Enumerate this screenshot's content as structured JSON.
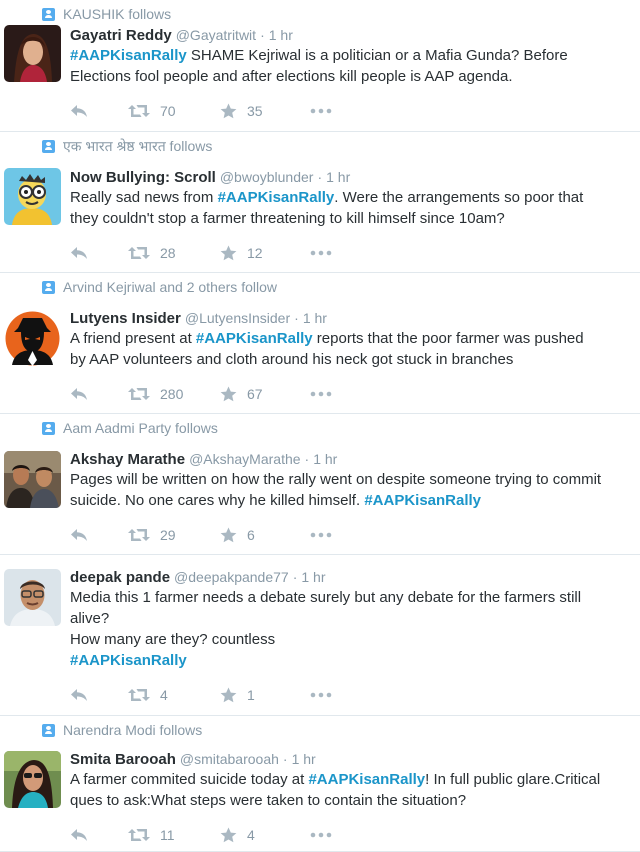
{
  "tweets": [
    {
      "context": "KAUSHIK follows",
      "fullname": "Gayatri Reddy",
      "handle": "@Gayatritwit",
      "time": "1 hr",
      "lines": [
        [
          {
            "text": "#AAPKisanRally",
            "hashtag": true
          },
          {
            "text": " SHAME Kejriwal is a politician or a Mafia Gunda? Before"
          }
        ],
        [
          {
            "text": "Elections fool people and after elections kill people is AAP agenda."
          }
        ]
      ],
      "retweets": "70",
      "favorites": "35",
      "avatar": "woman-portrait"
    },
    {
      "context": "एक भारत श्रेष्ठ भारत follows",
      "fullname": "Now Bullying: Scroll",
      "handle": "@bwoyblunder",
      "time": "1 hr",
      "lines": [
        [
          {
            "text": "Really sad news from "
          },
          {
            "text": "#AAPKisanRally",
            "hashtag": true
          },
          {
            "text": ". Were the arrangements so poor that"
          }
        ],
        [
          {
            "text": "they couldn't stop a farmer threatening to kill himself since 10am?"
          }
        ]
      ],
      "retweets": "28",
      "favorites": "12",
      "avatar": "cartoon-glasses"
    },
    {
      "context": "Arvind Kejriwal and 2 others follow",
      "fullname": "Lutyens Insider",
      "handle": "@LutyensInsider",
      "time": "1 hr",
      "lines": [
        [
          {
            "text": "A friend present at "
          },
          {
            "text": "#AAPKisanRally",
            "hashtag": true
          },
          {
            "text": " reports that the poor farmer was pushed"
          }
        ],
        [
          {
            "text": "by AAP volunteers and cloth around his neck got stuck in branches"
          }
        ]
      ],
      "retweets": "280",
      "favorites": "67",
      "avatar": "spy-silhouette"
    },
    {
      "context": "Aam Aadmi Party follows",
      "fullname": "Akshay Marathe",
      "handle": "@AkshayMarathe",
      "time": "1 hr",
      "lines": [
        [
          {
            "text": "Pages will be written on how the rally went on despite someone trying to commit"
          }
        ],
        [
          {
            "text": "suicide. No one cares why he killed himself. "
          },
          {
            "text": "#AAPKisanRally",
            "hashtag": true
          }
        ]
      ],
      "retweets": "29",
      "favorites": "6",
      "avatar": "group-photo"
    },
    {
      "context": "",
      "fullname": "deepak pande",
      "handle": "@deepakpande77",
      "time": "1 hr",
      "lines": [
        [
          {
            "text": "Media this 1 farmer needs a debate surely but any debate for the farmers still"
          }
        ],
        [
          {
            "text": "alive?"
          }
        ],
        [
          {
            "text": "How many are they? countless"
          }
        ],
        [
          {
            "text": "#AAPKisanRally",
            "hashtag": true
          }
        ]
      ],
      "retweets": "4",
      "favorites": "1",
      "avatar": "man-glasses"
    },
    {
      "context": "Narendra Modi follows",
      "fullname": "Smita Barooah",
      "handle": "@smitabarooah",
      "time": "1 hr",
      "lines": [
        [
          {
            "text": "A farmer commited suicide today at "
          },
          {
            "text": "#AAPKisanRally",
            "hashtag": true
          },
          {
            "text": "! In full public glare.Critical"
          }
        ],
        [
          {
            "text": "ques to ask:What steps were taken to contain the situation?"
          }
        ]
      ],
      "retweets": "11",
      "favorites": "4",
      "avatar": "woman-sunglasses"
    }
  ],
  "colors": {
    "hashtag": "#1b95c9",
    "meta": "#8899a6",
    "action": "#aab8c2",
    "context_icon": "#55acee"
  },
  "icons": {
    "context": "follow-person-icon",
    "reply": "reply-arrow-icon",
    "retweet": "retweet-icon",
    "favorite": "star-icon",
    "more": "more-dots-icon"
  }
}
